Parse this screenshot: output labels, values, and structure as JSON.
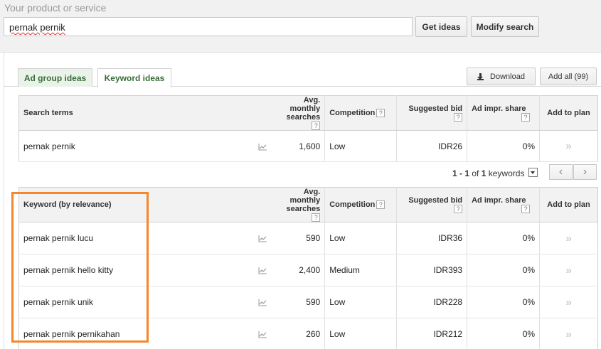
{
  "search_bar": {
    "label": "Your product or service",
    "value": "pernak pernik",
    "get_ideas_label": "Get ideas",
    "modify_search_label": "Modify search"
  },
  "tabs": [
    {
      "label": "Ad group ideas",
      "active": false
    },
    {
      "label": "Keyword ideas",
      "active": true
    }
  ],
  "actions": {
    "download_label": "Download",
    "add_all_label": "Add all (99)"
  },
  "columns": {
    "search_terms": "Search terms",
    "keyword": "Keyword (by relevance)",
    "avg_monthly_line1": "Avg. monthly",
    "avg_monthly_line2": "searches",
    "competition": "Competition",
    "suggested_bid": "Suggested bid",
    "ad_impr_line1": "Ad impr. share",
    "add_to_plan": "Add to plan",
    "help_glyph": "?"
  },
  "search_terms_rows": [
    {
      "term": "pernak pernik",
      "avg": "1,600",
      "competition": "Low",
      "bid": "IDR26",
      "share": "0%"
    }
  ],
  "pager": {
    "range_start": "1",
    "range_sep": " - ",
    "range_end": "1",
    "of_text": " of ",
    "total": "1",
    "unit": " keywords"
  },
  "keyword_rows": [
    {
      "term": "pernak pernik lucu",
      "avg": "590",
      "competition": "Low",
      "bid": "IDR36",
      "share": "0%"
    },
    {
      "term": "pernak pernik hello kitty",
      "avg": "2,400",
      "competition": "Medium",
      "bid": "IDR393",
      "share": "0%"
    },
    {
      "term": "pernak pernik unik",
      "avg": "590",
      "competition": "Low",
      "bid": "IDR228",
      "share": "0%"
    },
    {
      "term": "pernak pernik pernikahan",
      "avg": "260",
      "competition": "Low",
      "bid": "IDR212",
      "share": "0%"
    }
  ],
  "colors": {
    "highlight": "#f5862a",
    "tab_text": "#3a6e3a",
    "tab_inactive_bg": "#eaf3ea"
  },
  "icons": {
    "trend": "trend-chart-icon",
    "add": "double-chevron-right-icon",
    "download": "download-arrow-icon",
    "help": "question-mark-icon",
    "dropdown": "dropdown-arrow-icon",
    "prev": "chevron-left-icon",
    "next": "chevron-right-icon"
  }
}
